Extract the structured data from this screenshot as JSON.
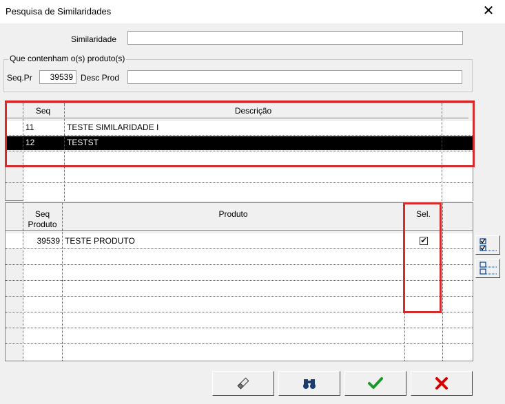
{
  "window": {
    "title": "Pesquisa de Similaridades",
    "close_glyph": "✕"
  },
  "form": {
    "similaridade_label": "Similaridade",
    "similaridade_value": "",
    "group_title": "Que contenham o(s) produto(s)",
    "seq_label": "Seq.Pr",
    "seq_value": "39539",
    "desc_label": "Desc Prod",
    "desc_value": ""
  },
  "similarity_grid": {
    "headers": {
      "seq": "Seq",
      "descricao": "Descrição"
    },
    "rows": [
      {
        "seq": "11",
        "descricao": "TESTE SIMILARIDADE I",
        "selected": false
      },
      {
        "seq": "12",
        "descricao": "TESTST",
        "selected": true
      }
    ]
  },
  "product_grid": {
    "headers": {
      "seq_line1": "Seq",
      "seq_line2": "Produto",
      "produto": "Produto",
      "sel": "Sel."
    },
    "rows": [
      {
        "seq": "39539",
        "produto": "TESTE PRODUTO",
        "checked": true
      }
    ]
  },
  "buttons": {
    "clear_icon": "eraser-icon",
    "search_icon": "binoculars-icon",
    "ok_icon": "checkmark-icon",
    "cancel_icon": "x-icon",
    "ok_color": "#1a9a2a",
    "cancel_color": "#d40000"
  },
  "side_buttons": {
    "select_all_icon": "check-all-icon",
    "deselect_all_icon": "uncheck-all-icon"
  },
  "highlight_color": "#d52b2b"
}
